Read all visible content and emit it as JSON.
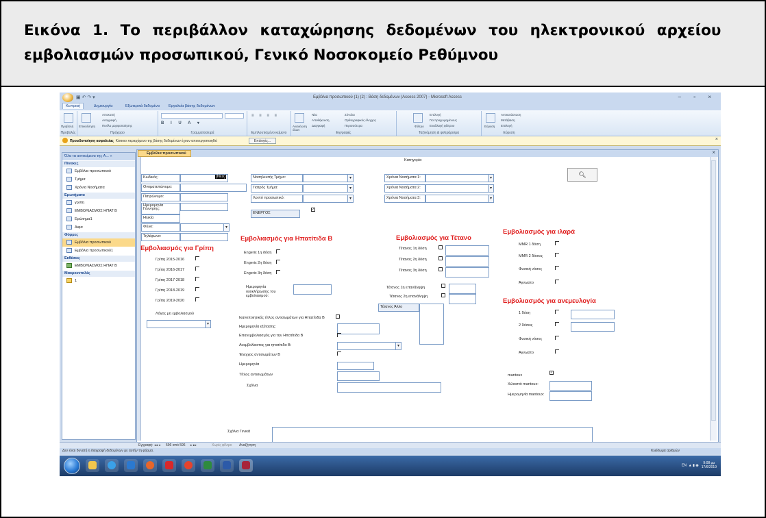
{
  "caption": {
    "line1": "Εικόνα 1. Το περιβάλλον καταχώρησης δεδομένων του ηλεκτρονικού αρχείου",
    "line2": "εμβολιασμών προσωπικού, Γενικό Νοσοκομείο Ρεθύμνου"
  },
  "app": {
    "window_title": "Εμβόλια προσωπικού (1) (2) : Βάση δεδομένων (Access 2007) - Microsoft Access",
    "tabs": [
      "Κεντρική",
      "Δημιουργία",
      "Εξωτερικά δεδομένα",
      "Εργαλεία βάσης δεδομένων"
    ],
    "active_tab": 0,
    "ribbon_groups": [
      "Προβολές",
      "Πρόχειρο",
      "Γραμματοσειρά",
      "Εμπλουτισμένο κείμενο",
      "Εγγραφές",
      "Ταξινόμηση & φιλτράρισμα",
      "Εύρεση"
    ],
    "ribbon_buttons": {
      "view": "Προβολή",
      "paste": "Επικόλληση",
      "cut": "Αποκοπή",
      "copy": "Αντιγραφή",
      "format_painter": "Πινέλο μορφοποίησης",
      "refresh": "Ανανέωση όλων",
      "new": "Νέα",
      "save": "Αποθήκευση",
      "delete": "Διαγραφή",
      "totals": "Σύνολα",
      "spelling": "Ορθογραφικός έλεγχος",
      "more": "Περισσότερα",
      "filter": "Φίλτρο",
      "selection": "Επιλογή",
      "advanced": "Για προχωρημένους",
      "toggle_filter": "Εναλλαγή φίλτρου",
      "find": "Εύρεση",
      "replace": "Αντικατάσταση",
      "goto": "Μετάβαση",
      "select": "Επιλογή"
    },
    "security": {
      "bold": "Προειδοποίηση ασφαλείας",
      "text": "Κάποιο περιεχόμενο της βάσης δεδομένων έχουν απενεργοποιηθεί",
      "options_button": "Επιλογές..."
    }
  },
  "nav_pane": {
    "header": "Όλα τα αντικείμενα της A... «",
    "sections": [
      {
        "title": "Πίνακες",
        "items": [
          "Εμβόλια προσωπικού",
          "Τμήμα",
          "Χρόνια Νοσήματα"
        ]
      },
      {
        "title": "Ερωτήματα",
        "items": [
          "γριπη",
          "ΕΜΒΟΛΙΑΣΜΟΣ ΗΠΑΤ Β",
          "Ερώτημα1",
          "Διφα"
        ]
      },
      {
        "title": "Φόρμες",
        "items": [
          "Εμβόλια προσωπικού",
          "Εμβόλια προσωπικού1"
        ]
      },
      {
        "title": "Εκθέσεις",
        "items": [
          "ΕΜΒΟΛΙΑΣΜΟΣ ΗΠΑΤ Β"
        ]
      },
      {
        "title": "Μακροεντολές",
        "items": [
          "1"
        ]
      }
    ],
    "selected": "Εμβόλια προσωπικού"
  },
  "document": {
    "tab": "Εμβόλια προσωπικού",
    "category_label": "Κατηγορία",
    "search_icon": "binoculars-icon"
  },
  "form": {
    "personal": {
      "code_label": "Κωδικός:",
      "code_value": "(Νέο)",
      "name_label": "Ονοματεπώνυμο:",
      "father_label": "Πατρώνυμο:",
      "dob_label": "Ημερομηνία Γέννησης:",
      "age_label": "Ηλικία",
      "sex_label": "Φύλο:",
      "phone_label": "Τηλέφωνο:"
    },
    "department": {
      "nursing_label": "Νοσηλευτής Τμήμα:",
      "doctor_label": "Γιατρός Τμήμα:",
      "other_label": "Λοιπό προσωπικό:",
      "active_label": "ΕΝΕΡΓΟΣ"
    },
    "chronic": [
      "Χρόνια Νοσήματα 1:",
      "Χρόνια Νοσήματα 2:",
      "Χρόνια Νοσήματα 3:"
    ],
    "flu": {
      "title": "Εμβολιασμός για Γρίπη",
      "items": [
        "Γρίπη 2015-2016",
        "Γρίπη 2016-2017",
        "Γρίπη 2017-2018",
        "Γρίπη 2018-2019",
        "Γρίπη 2019-2020"
      ],
      "reason_label": "Λόγος μη εμβολιασμού"
    },
    "hepb": {
      "title": "Εμβολιασμός για Ηπατίτιδα Β",
      "doses": [
        "Engerix 1η δόση",
        "Engerix 2η δόση",
        "Engerix 3η δόση"
      ],
      "completion_label": "Ημερομηνία ολοκλήρωσης του εμβολιασμού:",
      "titer_sufficient": "Ικανοποιητικός τίτλος αντισωμάτων για Ηπατίτιδα Β",
      "exam_date": "Ημερομηνία εξέτασης:",
      "revaccination": "Επανεμβολιασμός για την Ηπατίτιδα Β",
      "nonvac_reason": "Ανεμβολίαστος για ηπατίτιδα Β:",
      "ab_check": "Έλεγχος αντισωμάτων Β",
      "date": "Ημερομηνία",
      "titer": "Τίτλος αντισωμάτων",
      "comments": "Σχόλια"
    },
    "tetanus": {
      "title": "Εμβολιασμός για Τέτανο",
      "doses": [
        "Τέτανος 1η δόση",
        "Τέτανος 2η δόση",
        "Τέτανος 3η δόση"
      ],
      "boosters": [
        "Τέτανος 1η επανάληψη",
        "Τέτανος 2η επανάληψη"
      ],
      "other": "Τέτανος Άλλο"
    },
    "measles": {
      "title": "Εμβολιασμός για ιλαρά",
      "items": [
        "MMR 1 δόση",
        "MMR 2 δόσεις",
        "Φυσική νόσος",
        "Άγνωστο"
      ]
    },
    "varicella": {
      "title": "Εμβολιασμός για ανεμευλογία",
      "items": [
        "1 δόση",
        "2 δόσεις",
        "Φυσική νόσος",
        "Άγνωστο"
      ]
    },
    "mantoux": {
      "label": "mantoux",
      "result": "Χιλιοστά mantoux:",
      "date": "Ημερομηνία mantoux:"
    },
    "general_comments": "Σχόλια Γενικά"
  },
  "record_nav": {
    "label": "Εγγραφή:",
    "position": "596 από 596",
    "filter": "Χωρίς φίλτρο",
    "search": "Αναζήτηση"
  },
  "status": {
    "message": "Δεν είναι δυνατή η διαγραφή δεδομένων με αυτήν τη φόρμα.",
    "numlock": "Κλείδωμα αριθμών"
  },
  "taskbar": {
    "lang": "EN",
    "time": "9:08 μμ",
    "date": "17/6/2019"
  },
  "colors": {
    "section_heading": "#e02020",
    "ribbon": "#c9d9ef",
    "selected": "#fbd98a"
  }
}
